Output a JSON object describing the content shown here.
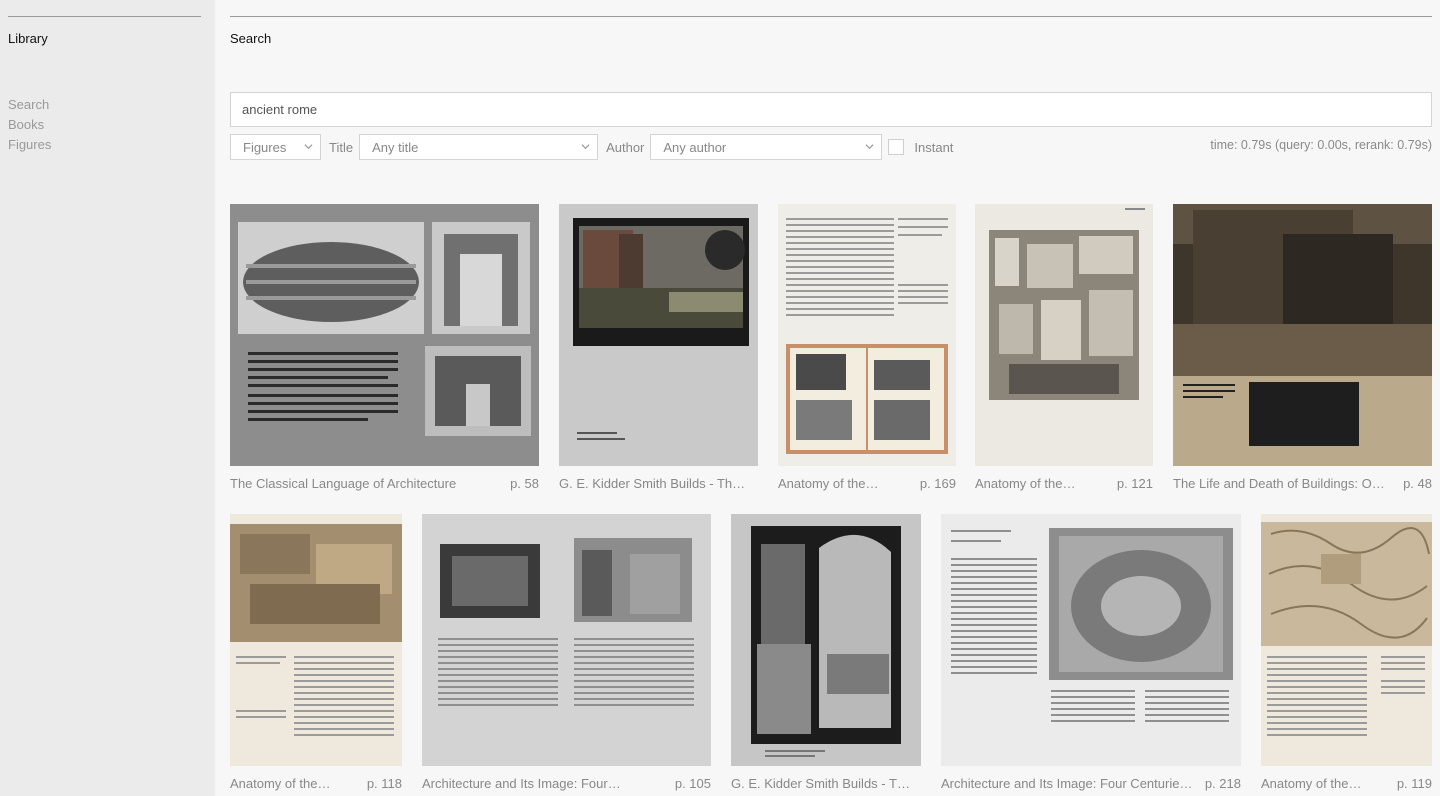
{
  "sidebar": {
    "title": "Library",
    "nav": [
      "Search",
      "Books",
      "Figures"
    ]
  },
  "main": {
    "title": "Search",
    "search": {
      "value": "ancient rome",
      "placeholder": ""
    },
    "filters": {
      "type_value": "Figures",
      "title_label": "Title",
      "title_value": "Any title",
      "author_label": "Author",
      "author_value": "Any author",
      "instant_label": "Instant",
      "instant_checked": false
    },
    "timing": "time: 0.79s (query: 0.00s, rerank: 0.79s)"
  },
  "results": [
    {
      "title": "The Classical Language of Architecture",
      "page": "p. 58"
    },
    {
      "title": "G. E. Kidder Smith Builds - The…",
      "page": ""
    },
    {
      "title": "Anatomy of the…",
      "page": "p. 169"
    },
    {
      "title": "Anatomy of the…",
      "page": "p. 121"
    },
    {
      "title": "The Life and Death of Buildings: O…",
      "page": "p. 48"
    },
    {
      "title": "Anatomy of the…",
      "page": "p. 118"
    },
    {
      "title": "Architecture and Its Image: Four…",
      "page": "p. 105"
    },
    {
      "title": "G. E. Kidder Smith Builds - Th…",
      "page": ""
    },
    {
      "title": "Architecture and Its Image: Four Centurie…",
      "page": "p. 218"
    },
    {
      "title": "Anatomy of the…",
      "page": "p. 119"
    }
  ]
}
